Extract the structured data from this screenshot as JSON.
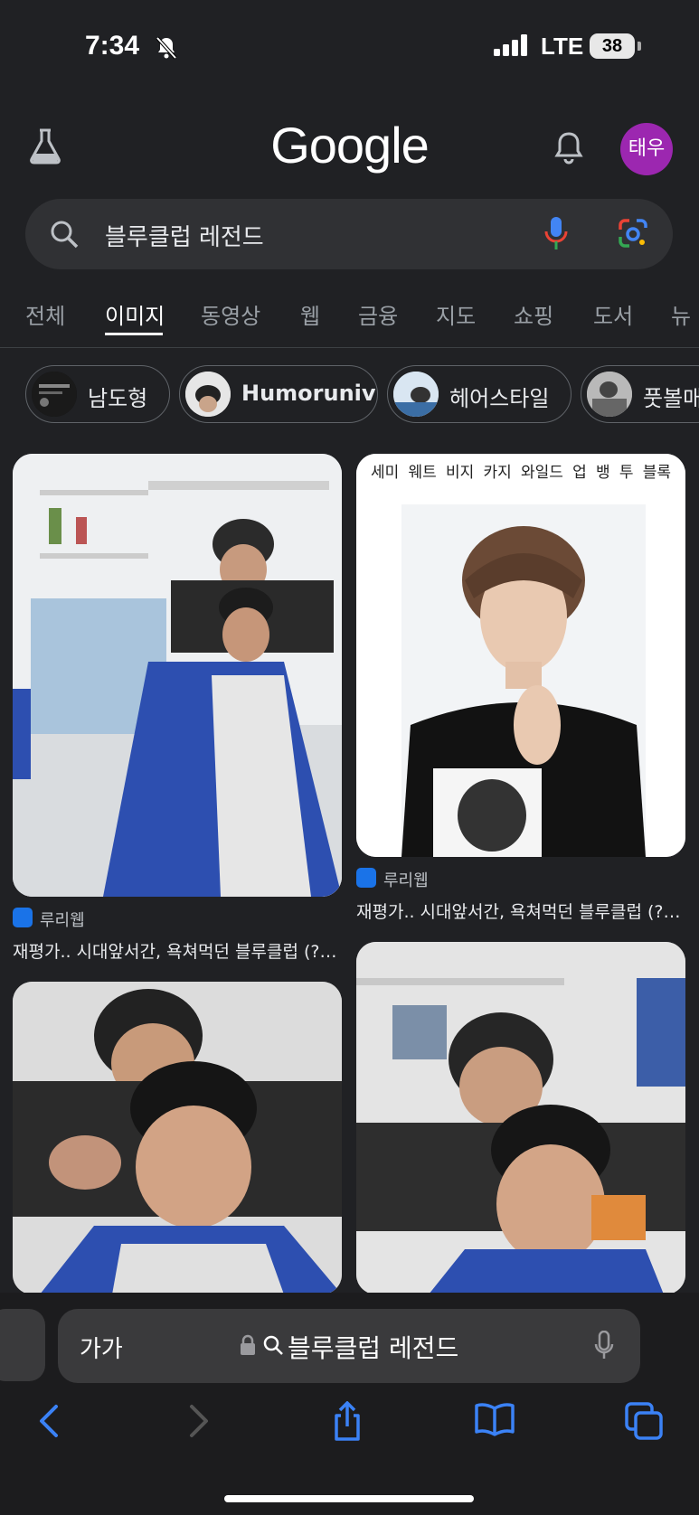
{
  "status_bar": {
    "time": "7:34",
    "network": "LTE",
    "battery": "38"
  },
  "header": {
    "logo": "Google",
    "avatar_text": "태우",
    "avatar_color": "#9c27b0"
  },
  "search": {
    "query": "블루클럽 레전드"
  },
  "tabs": [
    {
      "label": "전체",
      "active": false
    },
    {
      "label": "이미지",
      "active": true
    },
    {
      "label": "동영상",
      "active": false
    },
    {
      "label": "웹",
      "active": false
    },
    {
      "label": "금융",
      "active": false
    },
    {
      "label": "지도",
      "active": false
    },
    {
      "label": "쇼핑",
      "active": false
    },
    {
      "label": "도서",
      "active": false
    },
    {
      "label": "뉴",
      "active": false
    }
  ],
  "chips": [
    {
      "label": "남도형"
    },
    {
      "label": "Humoruniv"
    },
    {
      "label": "헤어스타일"
    },
    {
      "label": "풋볼매"
    }
  ],
  "results": [
    {
      "source": "루리웹",
      "caption": "재평가.. 시대앞서간, 욕쳐먹던 블루클럽 (?)..."
    },
    {
      "overlay_text": "세미 웨트 비지 카지 와일드 업 뱅 투 블록",
      "source": "루리웹",
      "caption": "재평가.. 시대앞서간, 욕쳐먹던 블루클럽 (?)..."
    },
    {
      "source": "",
      "caption": ""
    },
    {
      "source": "",
      "caption": ""
    }
  ],
  "browser": {
    "text_size_label": "가가",
    "address": "블루클럽 레전드"
  },
  "icons": [
    "labs-icon",
    "bell-icon",
    "search-icon",
    "mic-icon",
    "lens-icon",
    "back-icon",
    "forward-icon",
    "share-icon",
    "bookmarks-icon",
    "tabs-icon"
  ]
}
